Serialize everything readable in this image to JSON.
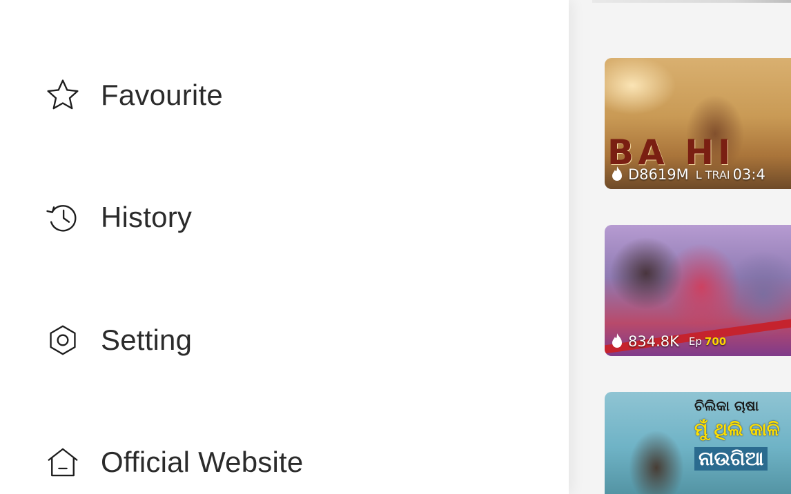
{
  "drawer": {
    "items": [
      {
        "label": "Favourite",
        "icon": "star-icon"
      },
      {
        "label": "History",
        "icon": "history-icon"
      },
      {
        "label": "Setting",
        "icon": "settings-hexagon-icon"
      },
      {
        "label": "Official Website",
        "icon": "home-icon"
      }
    ]
  },
  "content": {
    "videos": [
      {
        "title": "BA  HI",
        "views": "D8619M",
        "tag": "L TRAI",
        "duration": "03:4"
      },
      {
        "views": "834.8K",
        "ep_prefix": "Ep",
        "ep_number": "700"
      },
      {
        "line1": "ଚିଲିକା ଚାଷା",
        "line2": "ମୁଁ ଥିଲି କାଳି",
        "line3": "ନାଉଗିଆ"
      }
    ]
  },
  "colors": {
    "text": "#2b2b2b",
    "icon": "#1d1d1d",
    "drawer_bg": "#ffffff",
    "content_bg": "#f4f4f4"
  }
}
